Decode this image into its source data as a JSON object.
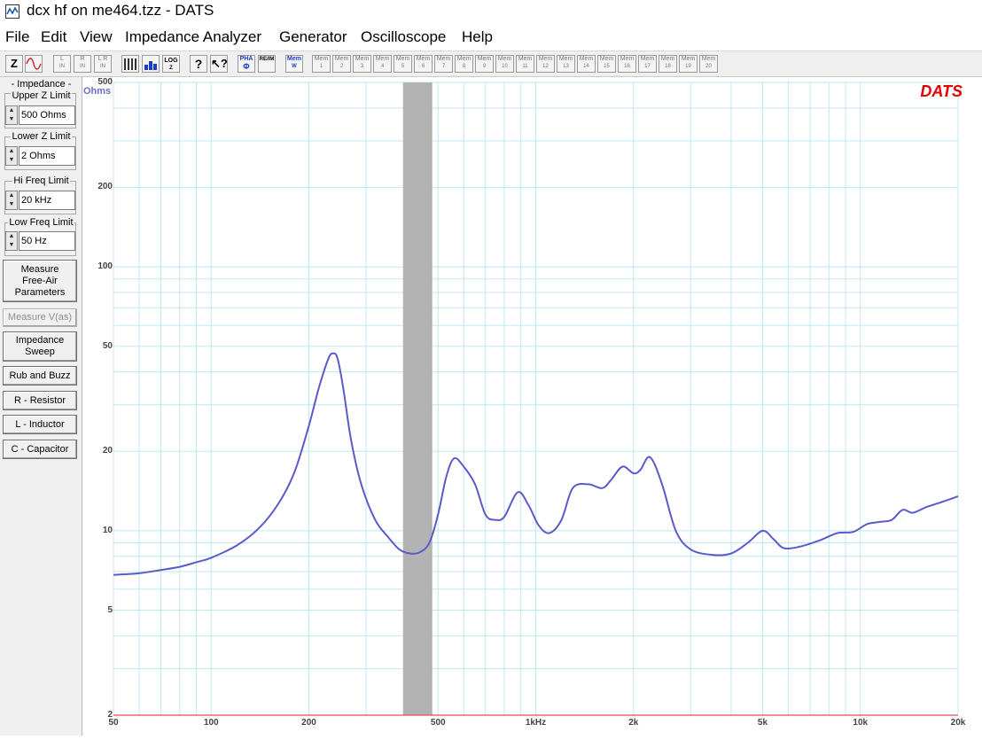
{
  "window": {
    "title": "dcx hf on me464.tzz - DATS"
  },
  "menu": [
    "File",
    "Edit",
    "View",
    "Impedance Analyzer",
    "Generator",
    "Oscilloscope",
    "Help"
  ],
  "toolbar": {
    "z_label": "Z",
    "lin_labels": [
      [
        "L",
        "IN"
      ],
      [
        "R",
        "IN"
      ],
      [
        "L R",
        "IN"
      ]
    ],
    "log_label": "LOG",
    "phase_label": "PHA",
    "reim_label": "RE/IM",
    "mem_label": "Mem",
    "mem_slots": [
      "1",
      "2",
      "3",
      "4",
      "5",
      "6",
      "7",
      "8",
      "9",
      "10",
      "11",
      "12",
      "13",
      "14",
      "15",
      "16",
      "17",
      "18",
      "19",
      "20"
    ]
  },
  "panel": {
    "impedance_caption": "- Impedance -",
    "upper_z": {
      "label": "Upper Z Limit",
      "value": "500 Ohms"
    },
    "lower_z": {
      "label": "Lower Z Limit",
      "value": "2 Ohms"
    },
    "hi_freq": {
      "label": "Hi Freq Limit",
      "value": "20 kHz"
    },
    "low_freq": {
      "label": "Low Freq Limit",
      "value": "50 Hz"
    },
    "buttons": {
      "measure_free_air": "Measure Free-Air Parameters",
      "measure_vas": "Measure V(as)",
      "impedance_sweep": "Impedance Sweep",
      "rub_buzz": "Rub and Buzz",
      "resistor": "R - Resistor",
      "inductor": "L - Inductor",
      "capacitor": "C - Capacitor"
    }
  },
  "chart": {
    "brand": "DATS",
    "unit": "Ohms",
    "colors": {
      "curve": "#5a5ac8",
      "grid": "#bfe8f0",
      "band": "#b3b3b3",
      "baseline": "#e05050"
    }
  },
  "chart_data": {
    "type": "line",
    "title": "",
    "xlabel": "",
    "ylabel": "Ohms",
    "x_scale": "log",
    "y_scale": "log",
    "xlim": [
      50,
      20000
    ],
    "ylim": [
      2,
      500
    ],
    "x_tick_labels": [
      "50",
      "100",
      "200",
      "500",
      "1kHz",
      "2k",
      "5k",
      "10k",
      "20k"
    ],
    "x_tick_values": [
      50,
      100,
      200,
      500,
      1000,
      2000,
      5000,
      10000,
      20000
    ],
    "y_tick_labels": [
      "500",
      "200",
      "100",
      "50",
      "20",
      "10",
      "5",
      "2"
    ],
    "y_tick_values": [
      500,
      200,
      100,
      50,
      20,
      10,
      5,
      2
    ],
    "highlight_band_x": [
      390,
      480
    ],
    "grid": true,
    "series": [
      {
        "x": [
          50,
          60,
          70,
          80,
          90,
          100,
          120,
          140,
          160,
          180,
          200,
          215,
          230,
          238,
          245,
          255,
          270,
          290,
          320,
          350,
          380,
          410,
          440,
          470,
          500,
          530,
          560,
          600,
          650,
          700,
          750,
          800,
          880,
          950,
          1020,
          1100,
          1200,
          1300,
          1450,
          1600,
          1700,
          1850,
          2000,
          2100,
          2250,
          2450,
          2700,
          3000,
          3500,
          4000,
          4500,
          5000,
          5400,
          5800,
          6500,
          7500,
          8500,
          9500,
          10500,
          11500,
          12500,
          13500,
          14500,
          16000,
          18000,
          20000
        ],
        "y": [
          6.8,
          6.9,
          7.1,
          7.3,
          7.6,
          7.9,
          8.8,
          10.2,
          12.5,
          16.5,
          25,
          35,
          45,
          47,
          45,
          35,
          22,
          15,
          11,
          9.5,
          8.5,
          8.2,
          8.3,
          9,
          11.5,
          16,
          18.8,
          17.5,
          15,
          11.5,
          11,
          11.3,
          14,
          12.5,
          10.5,
          9.8,
          11,
          14.5,
          15,
          14.5,
          15.5,
          17.5,
          16.5,
          17,
          19,
          15,
          10,
          8.5,
          8.1,
          8.2,
          9,
          10,
          9.3,
          8.6,
          8.7,
          9.2,
          9.8,
          9.9,
          10.6,
          10.8,
          11,
          12,
          11.7,
          12.3,
          12.9,
          13.5
        ]
      }
    ]
  }
}
